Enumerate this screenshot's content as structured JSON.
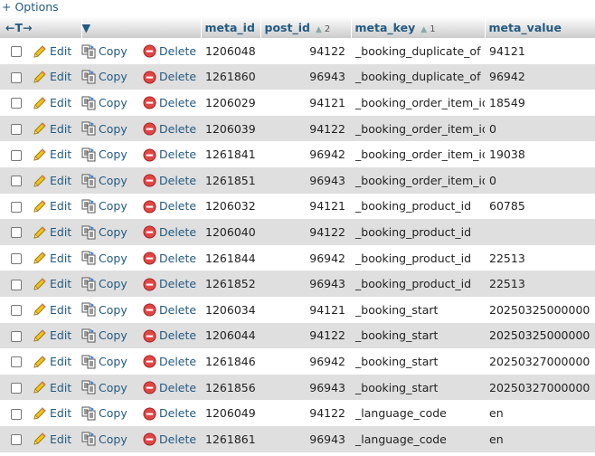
{
  "options_link": "+ Options",
  "header": {
    "columns": [
      {
        "label": "meta_id"
      },
      {
        "label": "post_id",
        "sort_index": "2"
      },
      {
        "label": "meta_key",
        "sort_index": "1"
      },
      {
        "label": "meta_value"
      }
    ]
  },
  "actions": {
    "edit": "Edit",
    "copy": "Copy",
    "delete": "Delete"
  },
  "rows": [
    {
      "meta_id": "1206048",
      "post_id": "94122",
      "meta_key": "_booking_duplicate_of",
      "meta_value": "94121"
    },
    {
      "meta_id": "1261860",
      "post_id": "96943",
      "meta_key": "_booking_duplicate_of",
      "meta_value": "96942"
    },
    {
      "meta_id": "1206029",
      "post_id": "94121",
      "meta_key": "_booking_order_item_id",
      "meta_value": "18549"
    },
    {
      "meta_id": "1206039",
      "post_id": "94122",
      "meta_key": "_booking_order_item_id",
      "meta_value": "0"
    },
    {
      "meta_id": "1261841",
      "post_id": "96942",
      "meta_key": "_booking_order_item_id",
      "meta_value": "19038"
    },
    {
      "meta_id": "1261851",
      "post_id": "96943",
      "meta_key": "_booking_order_item_id",
      "meta_value": "0"
    },
    {
      "meta_id": "1206032",
      "post_id": "94121",
      "meta_key": "_booking_product_id",
      "meta_value": "60785"
    },
    {
      "meta_id": "1206040",
      "post_id": "94122",
      "meta_key": "_booking_product_id",
      "meta_value": ""
    },
    {
      "meta_id": "1261844",
      "post_id": "96942",
      "meta_key": "_booking_product_id",
      "meta_value": "22513"
    },
    {
      "meta_id": "1261852",
      "post_id": "96943",
      "meta_key": "_booking_product_id",
      "meta_value": "22513"
    },
    {
      "meta_id": "1206034",
      "post_id": "94121",
      "meta_key": "_booking_start",
      "meta_value": "20250325000000"
    },
    {
      "meta_id": "1206044",
      "post_id": "94122",
      "meta_key": "_booking_start",
      "meta_value": "20250325000000"
    },
    {
      "meta_id": "1261846",
      "post_id": "96942",
      "meta_key": "_booking_start",
      "meta_value": "20250327000000"
    },
    {
      "meta_id": "1261856",
      "post_id": "96943",
      "meta_key": "_booking_start",
      "meta_value": "20250327000000"
    },
    {
      "meta_id": "1206049",
      "post_id": "94122",
      "meta_key": "_language_code",
      "meta_value": "en"
    },
    {
      "meta_id": "1261861",
      "post_id": "96943",
      "meta_key": "_language_code",
      "meta_value": "en"
    }
  ]
}
